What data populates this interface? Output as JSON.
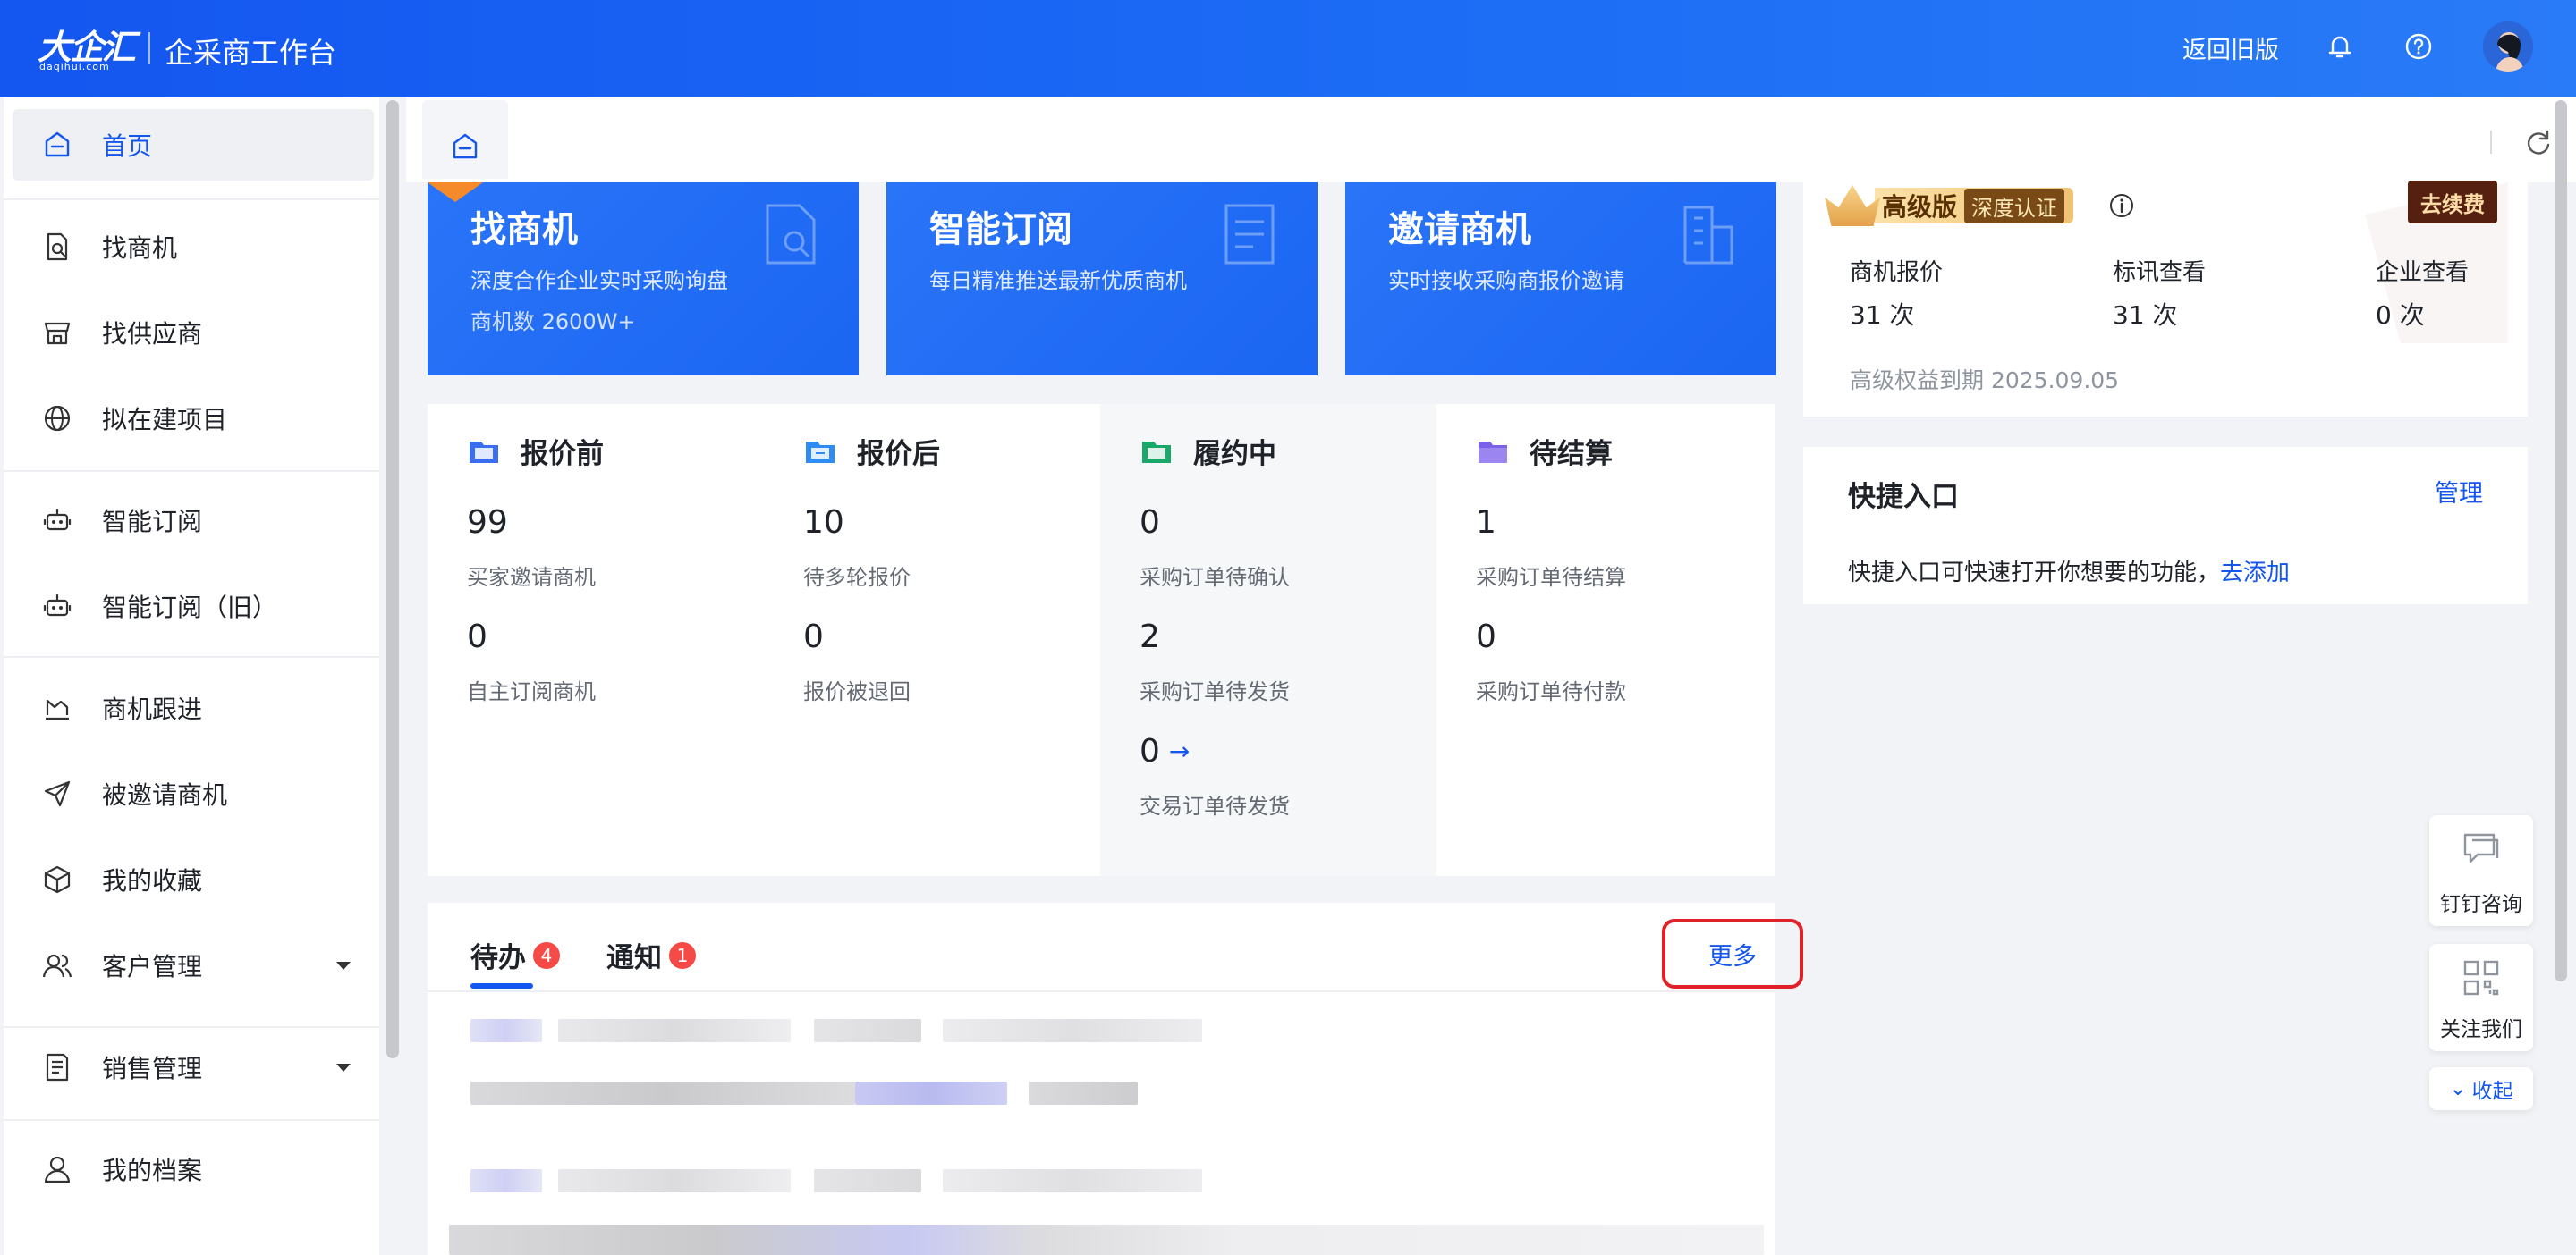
{
  "header": {
    "logo_text": "大企汇",
    "logo_sub": "daqihui.com",
    "app_title": "企采商工作台",
    "back_old": "返回旧版",
    "icons": [
      "bell-icon",
      "help-icon"
    ]
  },
  "sidebar": {
    "items": [
      {
        "label": "首页",
        "icon": "home-icon"
      },
      {
        "label": "找商机",
        "icon": "doc-search-icon"
      },
      {
        "label": "找供应商",
        "icon": "store-icon"
      },
      {
        "label": "拟在建项目",
        "icon": "globe-icon"
      },
      {
        "label": "智能订阅",
        "icon": "robot-icon"
      },
      {
        "label": "智能订阅（旧）",
        "icon": "robot-icon"
      },
      {
        "label": "商机跟进",
        "icon": "chart-icon"
      },
      {
        "label": "被邀请商机",
        "icon": "send-icon"
      },
      {
        "label": "我的收藏",
        "icon": "box-icon"
      },
      {
        "label": "客户管理",
        "icon": "users-icon"
      },
      {
        "label": "销售管理",
        "icon": "list-icon"
      },
      {
        "label": "我的档案",
        "icon": "user-icon"
      }
    ]
  },
  "banners": [
    {
      "title": "找商机",
      "desc": "深度合作企业实时采购询盘",
      "count": "商机数 2600W+"
    },
    {
      "title": "智能订阅",
      "desc": "每日精准推送最新优质商机",
      "count": ""
    },
    {
      "title": "邀请商机",
      "desc": "实时接收采购商报价邀请",
      "count": ""
    }
  ],
  "stats": [
    {
      "title": "报价前",
      "color": "#3a6df0",
      "rows": [
        {
          "value": "99",
          "label": "买家邀请商机"
        },
        {
          "value": "0",
          "label": "自主订阅商机"
        }
      ]
    },
    {
      "title": "报价后",
      "color": "#2f8cf5",
      "rows": [
        {
          "value": "10",
          "label": "待多轮报价"
        },
        {
          "value": "0",
          "label": "报价被退回"
        }
      ]
    },
    {
      "title": "履约中",
      "color": "#1aa86a",
      "rows": [
        {
          "value": "0",
          "label": "采购订单待确认"
        },
        {
          "value": "2",
          "label": "采购订单待发货"
        },
        {
          "value": "0",
          "label": "交易订单待发货"
        }
      ]
    },
    {
      "title": "待结算",
      "color": "#7b61e8",
      "rows": [
        {
          "value": "1",
          "label": "采购订单待结算"
        },
        {
          "value": "0",
          "label": "采购订单待付款"
        }
      ]
    }
  ],
  "todo": {
    "tabs": [
      {
        "label": "待办",
        "badge": "4"
      },
      {
        "label": "通知",
        "badge": "1"
      }
    ],
    "more": "更多"
  },
  "vip": {
    "level": "高级版",
    "tag": "深度认证",
    "renew": "去续费",
    "quotas": [
      {
        "label": "商机报价",
        "value": "31 次"
      },
      {
        "label": "标讯查看",
        "value": "31 次"
      },
      {
        "label": "企业查看",
        "value": "0 次"
      }
    ],
    "expiry": "高级权益到期 2025.09.05"
  },
  "quick_entry": {
    "title": "快捷入口",
    "manage": "管理",
    "desc": "快捷入口可快速打开你想要的功能，",
    "add": "去添加"
  },
  "float": {
    "dingtalk": "钉钉咨询",
    "follow": "关注我们",
    "collapse": "收起"
  },
  "colors": {
    "primary": "#1456f0",
    "badge_red": "#f54a45",
    "highlight_border": "#e0212a"
  }
}
